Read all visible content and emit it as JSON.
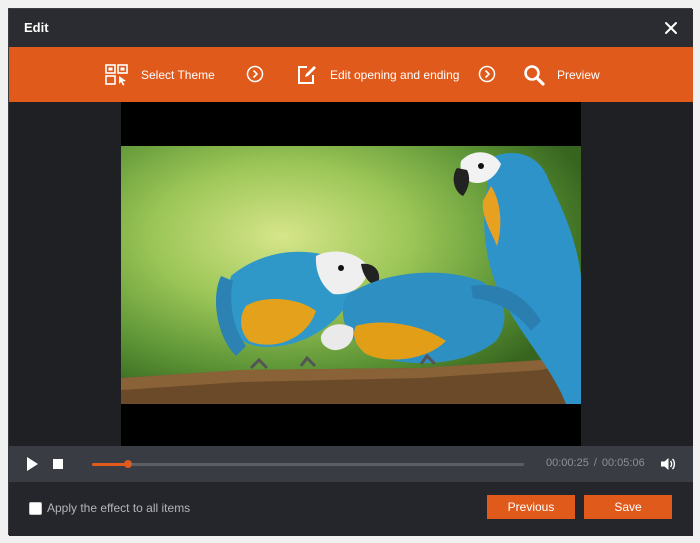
{
  "window": {
    "title": "Edit"
  },
  "steps": [
    {
      "label": "Select Theme",
      "icon": "theme-grid-icon"
    },
    {
      "label": "Edit opening and ending",
      "icon": "edit-icon"
    },
    {
      "label": "Preview",
      "icon": "search-icon"
    }
  ],
  "player": {
    "current_time": "00:00:25",
    "total_time": "00:05:06",
    "progress_fraction": 0.083
  },
  "footer": {
    "apply_label": "Apply the effect to all items",
    "apply_checked": false,
    "previous_label": "Previous",
    "save_label": "Save"
  },
  "colors": {
    "accent": "#e05a1c",
    "background": "#24262b"
  }
}
